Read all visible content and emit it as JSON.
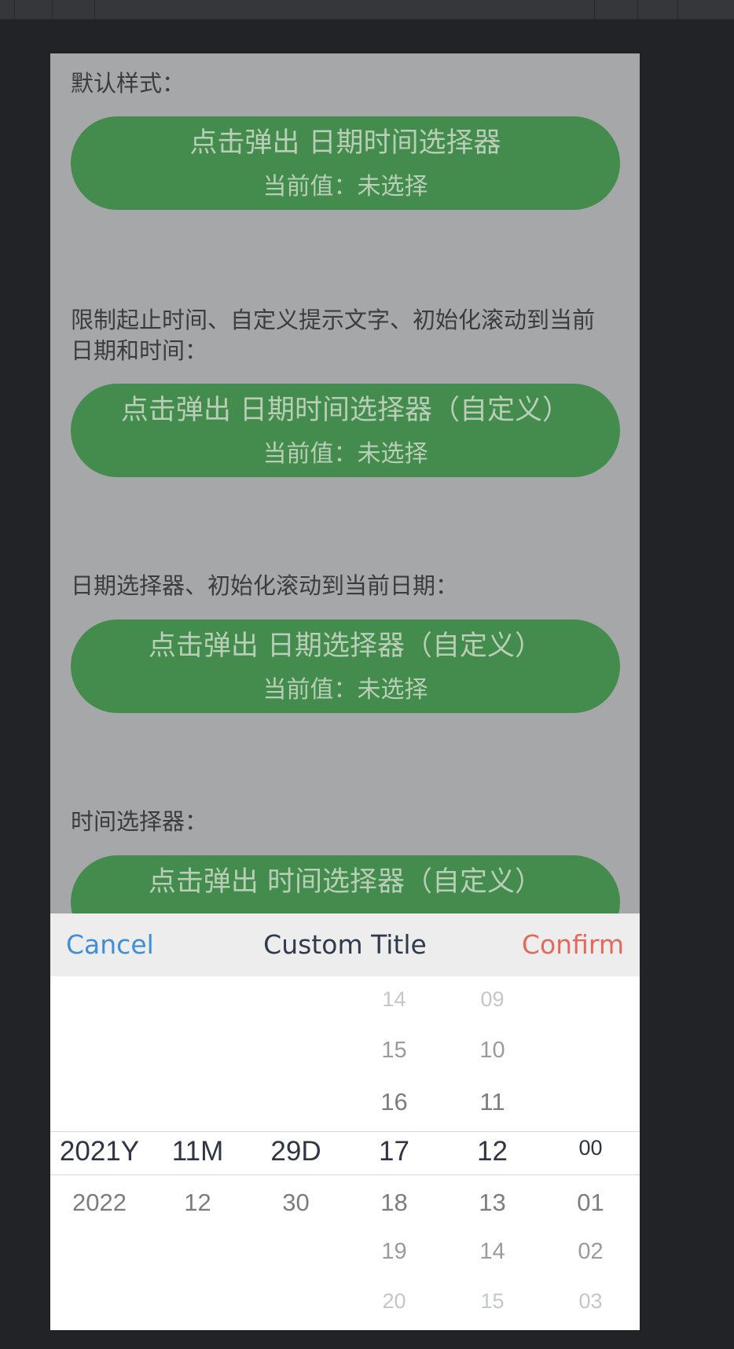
{
  "sections": [
    {
      "label": "默认样式：",
      "button": "点击弹出 日期时间选择器",
      "value": "当前值：未选择"
    },
    {
      "label": "限制起止时间、自定义提示文字、初始化滚动到当前日期和时间：",
      "button": "点击弹出 日期时间选择器（自定义）",
      "value": "当前值：未选择"
    },
    {
      "label": "日期选择器、初始化滚动到当前日期：",
      "button": "点击弹出 日期选择器（自定义）",
      "value": "当前值：未选择"
    },
    {
      "label": "时间选择器：",
      "button": "点击弹出 时间选择器（自定义）",
      "value": ""
    }
  ],
  "picker": {
    "cancel": "Cancel",
    "title": "Custom Title",
    "confirm": "Confirm",
    "columns": [
      {
        "name": "year",
        "above": [],
        "selected": "2021Y",
        "below": [
          "2022"
        ]
      },
      {
        "name": "month",
        "above": [],
        "selected": "11M",
        "below": [
          "12"
        ]
      },
      {
        "name": "day",
        "above": [],
        "selected": "29D",
        "below": [
          "30"
        ]
      },
      {
        "name": "hour",
        "above": [
          "14",
          "15",
          "16"
        ],
        "selected": "17",
        "below": [
          "18",
          "19",
          "20"
        ]
      },
      {
        "name": "minute",
        "above": [
          "09",
          "10",
          "11"
        ],
        "selected": "12",
        "below": [
          "13",
          "14",
          "15"
        ]
      },
      {
        "name": "second",
        "above": [],
        "selected": "00",
        "below": [
          "01",
          "02",
          "03"
        ]
      }
    ]
  },
  "colors": {
    "button_green": "#448b4e",
    "cancel_blue": "#3f8ed6",
    "confirm_red": "#e26a5c",
    "overlay_gray": "#a6a7a9"
  }
}
